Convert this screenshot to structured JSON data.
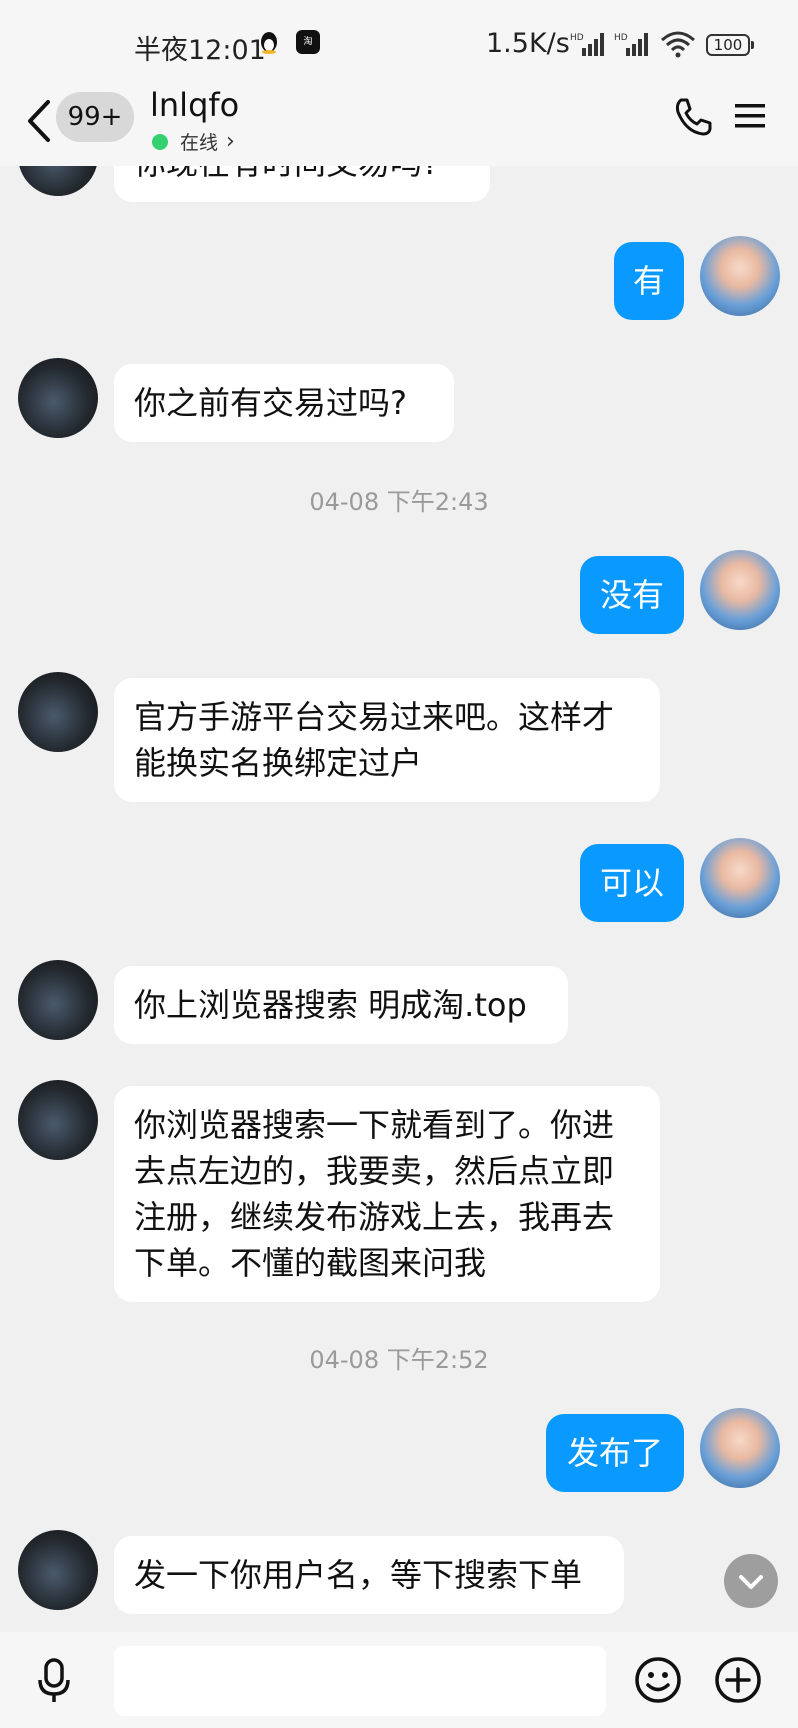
{
  "status_bar": {
    "time": "半夜12:01",
    "net_speed": "1.5K/s",
    "signal1_label": "HD",
    "signal2_label": "HD",
    "battery": "100",
    "app_icon_text": "淘"
  },
  "header": {
    "unread_count": "99+",
    "contact_name": "lnlqfo",
    "status": "在线",
    "status_chevron": "›"
  },
  "messages": [
    {
      "type": "in",
      "text": "你现在有时间交易吗?"
    },
    {
      "type": "out",
      "text": "有"
    },
    {
      "type": "in",
      "text": "你之前有交易过吗?"
    },
    {
      "type": "time",
      "text": "04-08 下午2:43"
    },
    {
      "type": "out",
      "text": "没有"
    },
    {
      "type": "in",
      "text": "官方手游平台交易过来吧。这样才\n能换实名换绑定过户"
    },
    {
      "type": "out",
      "text": "可以"
    },
    {
      "type": "in",
      "text": "你上浏览器搜索 明成淘.top"
    },
    {
      "type": "in",
      "text": "你浏览器搜索一下就看到了。你进\n去点左边的，我要卖，然后点立即\n注册，继续发布游戏上去，我再去\n下单。不懂的截图来问我"
    },
    {
      "type": "time",
      "text": "04-08 下午2:52"
    },
    {
      "type": "out",
      "text": "发布了"
    },
    {
      "type": "in",
      "text": "发一下你用户名，等下搜索下单"
    }
  ],
  "input": {
    "placeholder": "",
    "value": ""
  },
  "icons": {
    "back": "chevron-left-icon",
    "phone": "phone-icon",
    "menu": "menu-icon",
    "mic": "microphone-icon",
    "emoji": "smiley-icon",
    "plus": "plus-circle-icon",
    "scroll": "chevron-down-icon"
  },
  "colors": {
    "outgoing_bubble": "#0a99ff",
    "incoming_bubble": "#ffffff",
    "online_dot": "#33d26f",
    "background": "#f0f0f0"
  }
}
